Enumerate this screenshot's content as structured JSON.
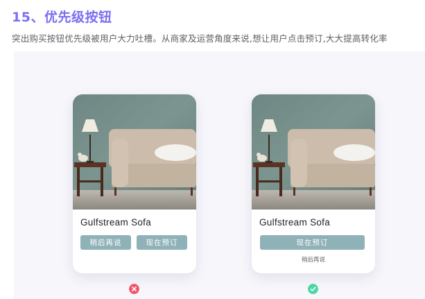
{
  "header": {
    "title": "15、优先级按钮",
    "description": "突出购买按钮优先级被用户大力吐槽。从商家及运营角度来说,想让用户点击预订,大大提高转化率"
  },
  "examples": [
    {
      "verdict": "incorrect",
      "verdict_icon": "cross-icon",
      "verdict_color": "#f1576c",
      "product_name": "Gulfstream Sofa",
      "buttons": [
        "稍后再说",
        "现在预订"
      ]
    },
    {
      "verdict": "correct",
      "verdict_icon": "check-icon",
      "verdict_color": "#4cd6a4",
      "product_name": "Gulfstream Sofa",
      "primary_button": "现在预订",
      "secondary_link": "稍后再说"
    }
  ],
  "colors": {
    "accent": "#7c6ef2",
    "button": "#8fb2b8",
    "wall": "#78908c"
  }
}
